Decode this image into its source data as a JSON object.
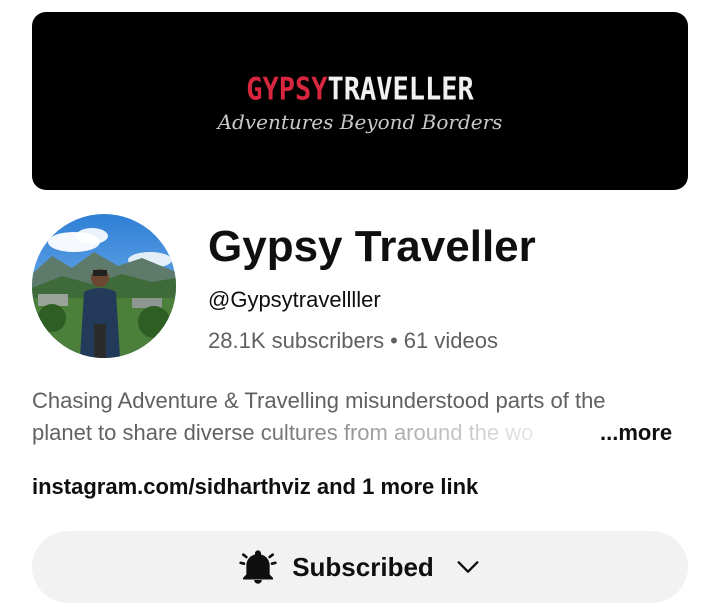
{
  "banner": {
    "logo_part1": "GYPSY",
    "logo_part2": "TRAVELLER",
    "tagline": "Adventures Beyond Borders",
    "bg_color": "#000000",
    "logo_red": "#d7263d"
  },
  "channel": {
    "name": "Gypsy Traveller",
    "handle": "@Gypsytravellller",
    "subscribers": "28.1K subscribers",
    "separator": "•",
    "videos": "61 videos"
  },
  "description": {
    "line1": "Chasing Adventure & Travelling misunderstood parts of the",
    "line2": "planet to share diverse cultures from around the wo",
    "more_label": "...more"
  },
  "links": {
    "primary": "instagram.com/sidharthviz",
    "rest": "and 1 more link"
  },
  "subscribe_button": {
    "label": "Subscribed",
    "icon": "bell-icon",
    "dropdown_icon": "chevron-down-icon",
    "bg_color": "#f2f2f2"
  }
}
